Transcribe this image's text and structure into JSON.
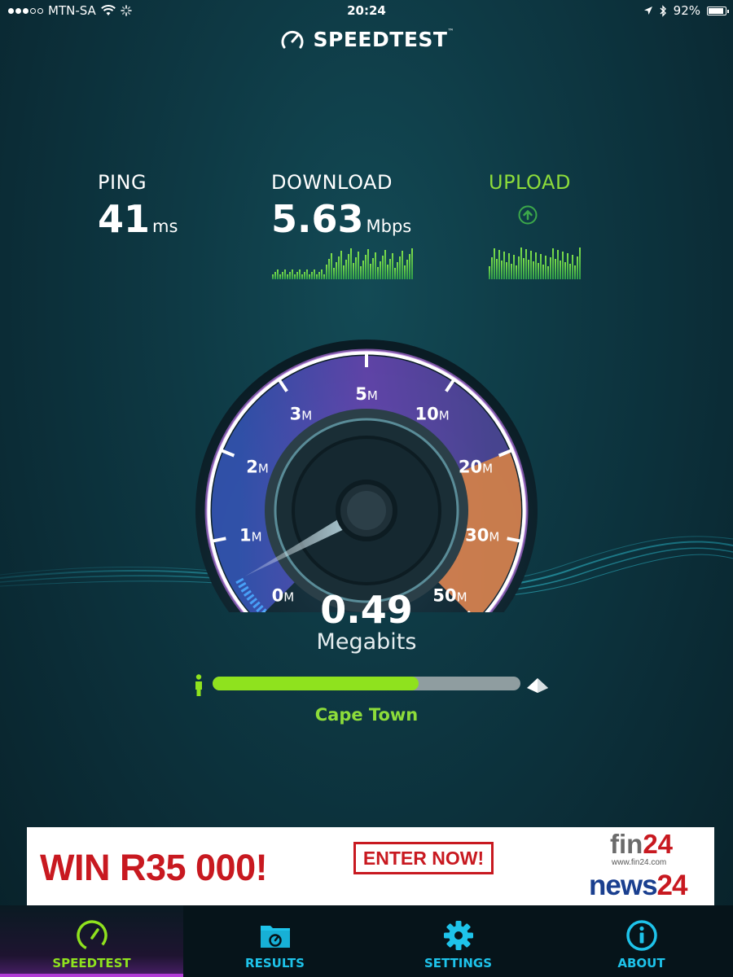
{
  "status_bar": {
    "carrier": "MTN-SA",
    "signal_bars_filled": 3,
    "signal_bars_total": 5,
    "time": "20:24",
    "battery_percent": "92%"
  },
  "app": {
    "title": "SPEEDTEST",
    "trademark": "™"
  },
  "metrics": {
    "ping": {
      "label": "PING",
      "value": "41",
      "unit": "ms"
    },
    "download": {
      "label": "DOWNLOAD",
      "value": "5.63",
      "unit": "Mbps"
    },
    "upload": {
      "label": "UPLOAD",
      "icon": "arrow-up-circle-icon"
    }
  },
  "gauge": {
    "scale": [
      "0",
      "1",
      "2",
      "3",
      "5",
      "10",
      "20",
      "30",
      "50"
    ],
    "scale_unit": "M",
    "current_value": "0.49",
    "current_unit": "Megabits",
    "accent_color": "#a86bd6",
    "high_zone_color": "#e88a3c"
  },
  "progress": {
    "fraction": 0.67,
    "location": "Cape Town",
    "fill_color": "#8fe21e"
  },
  "ad": {
    "headline": "WIN R35 000!",
    "button": "ENTER NOW!",
    "brand1_a": "fin",
    "brand1_b": "24",
    "brand1_url": "www.fin24.com",
    "brand2_a": "news",
    "brand2_b": "24"
  },
  "tabs": [
    {
      "label": "SPEEDTEST",
      "icon": "speedometer-icon",
      "active": true
    },
    {
      "label": "RESULTS",
      "icon": "results-folder-icon",
      "active": false
    },
    {
      "label": "SETTINGS",
      "icon": "gear-icon",
      "active": false
    },
    {
      "label": "ABOUT",
      "icon": "info-icon",
      "active": false
    }
  ]
}
